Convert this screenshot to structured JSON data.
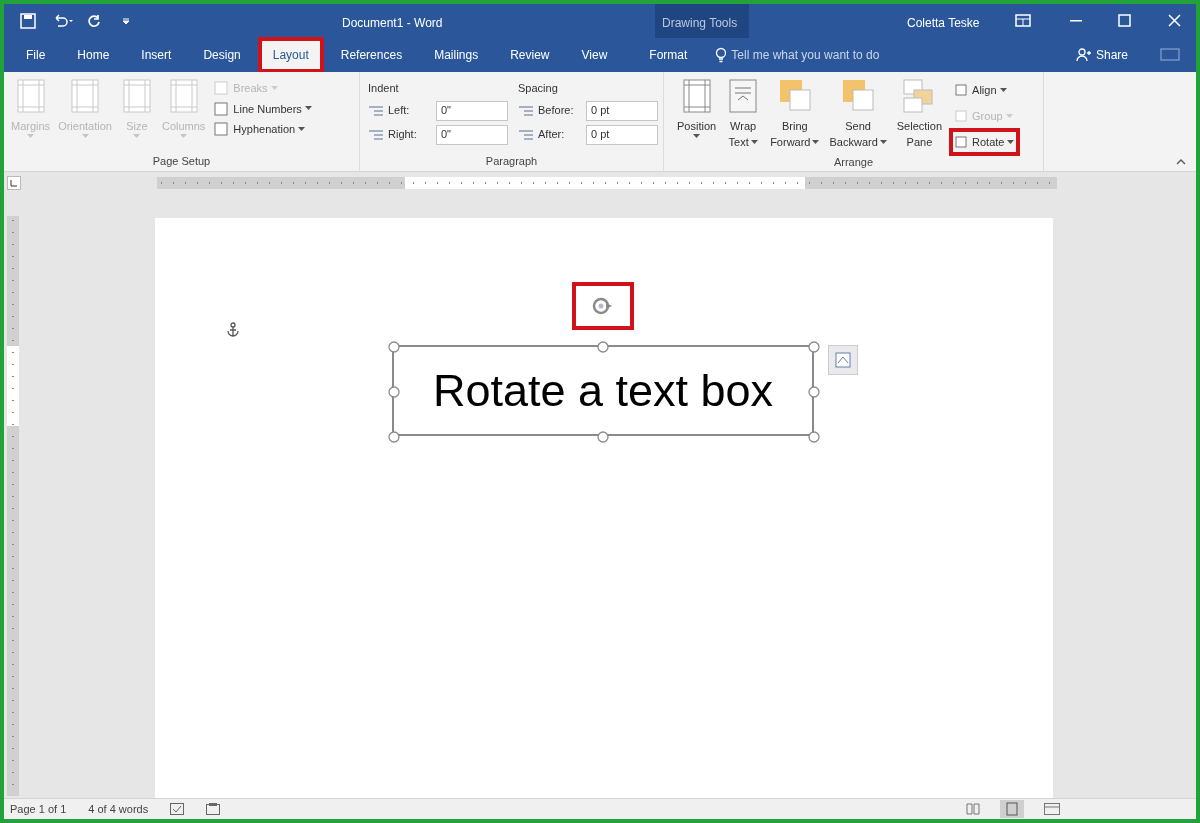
{
  "title_bar": {
    "title": "Document1 - Word",
    "context_label": "Drawing Tools",
    "user": "Coletta Teske"
  },
  "tabs": [
    {
      "label": "File",
      "selected": false,
      "highlighted": false
    },
    {
      "label": "Home",
      "selected": false,
      "highlighted": false
    },
    {
      "label": "Insert",
      "selected": false,
      "highlighted": false
    },
    {
      "label": "Design",
      "selected": false,
      "highlighted": false
    },
    {
      "label": "Layout",
      "selected": true,
      "highlighted": true
    },
    {
      "label": "References",
      "selected": false,
      "highlighted": false
    },
    {
      "label": "Mailings",
      "selected": false,
      "highlighted": false
    },
    {
      "label": "Review",
      "selected": false,
      "highlighted": false
    },
    {
      "label": "View",
      "selected": false,
      "highlighted": false
    },
    {
      "label": "Format",
      "selected": false,
      "highlighted": false
    }
  ],
  "tell_me": {
    "placeholder": "Tell me what you want to do"
  },
  "share": "Share",
  "page_setup": {
    "label": "Page Setup",
    "large_buttons": [
      {
        "label": "Margins",
        "disabled": true
      },
      {
        "label": "Orientation",
        "disabled": true
      },
      {
        "label": "Size",
        "disabled": true
      },
      {
        "label": "Columns",
        "disabled": true
      }
    ],
    "small_buttons": [
      {
        "label": "Breaks",
        "disabled": true
      },
      {
        "label": "Line Numbers",
        "disabled": false
      },
      {
        "label": "Hyphenation",
        "disabled": false
      }
    ]
  },
  "paragraph": {
    "label": "Paragraph",
    "indent_label": "Indent",
    "spacing_label": "Spacing",
    "indent": [
      {
        "label": "Left:",
        "value": "0\""
      },
      {
        "label": "Right:",
        "value": "0\""
      }
    ],
    "spacing": [
      {
        "label": "Before:",
        "value": "0 pt"
      },
      {
        "label": "After:",
        "value": "0 pt"
      }
    ]
  },
  "arrange": {
    "label": "Arrange",
    "large_buttons": [
      {
        "label": "Position",
        "caret": true
      },
      {
        "label": "Wrap Text",
        "caret": true
      },
      {
        "label": "Bring Forward",
        "caret": true
      },
      {
        "label": "Send Backward",
        "caret": true
      },
      {
        "label": "Selection Pane",
        "caret": false
      }
    ],
    "small_buttons": [
      {
        "label": "Align",
        "disabled": false,
        "highlighted": false
      },
      {
        "label": "Group",
        "disabled": true,
        "highlighted": false
      },
      {
        "label": "Rotate",
        "disabled": false,
        "highlighted": true
      }
    ]
  },
  "document": {
    "text_box": "Rotate a text box",
    "rotate_handle_highlighted": true
  },
  "status_bar": {
    "page": "Page 1 of 1",
    "words": "4 of 4 words"
  }
}
